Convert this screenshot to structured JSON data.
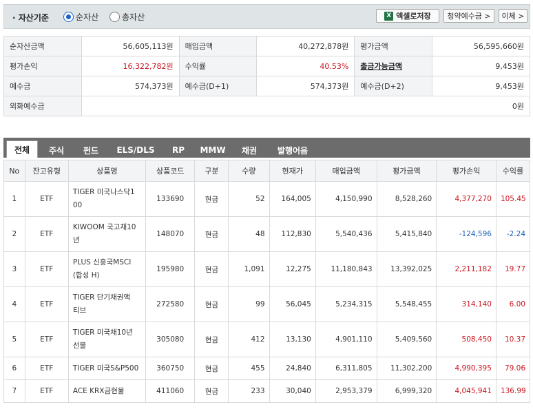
{
  "top": {
    "basis_label": "· 자산기준",
    "radio_net": "순자산",
    "radio_total": "총자산",
    "excel_button": "엑셀로저장",
    "subscription_button": "청약예수금 >",
    "transfer_button": "이체 >"
  },
  "summary": {
    "net_assets_label": "순자산금액",
    "net_assets": "56,605,113원",
    "purchase_label": "매입금액",
    "purchase": "40,272,878원",
    "valuation_label": "평가금액",
    "valuation": "56,595,660원",
    "pnl_label": "평가손익",
    "pnl": "16,322,782원",
    "return_label": "수익률",
    "return": "40.53%",
    "withdrawable_label": "출금가능금액",
    "withdrawable": "9,453원",
    "deposit_label": "예수금",
    "deposit": "574,373원",
    "deposit_d1_label": "예수금(D+1)",
    "deposit_d1": "574,373원",
    "deposit_d2_label": "예수금(D+2)",
    "deposit_d2": "9,453원",
    "fx_label": "외화예수금",
    "fx": "0원"
  },
  "tabs": [
    "전체",
    "주식",
    "펀드",
    "ELS/DLS",
    "RP",
    "MMW",
    "채권",
    "발행어음"
  ],
  "table": {
    "headers": [
      "No",
      "잔고유형",
      "상품명",
      "상품코드",
      "구분",
      "수량",
      "현재가",
      "매입금액",
      "평가금액",
      "평가손익",
      "수익률"
    ],
    "rows": [
      {
        "no": "1",
        "type": "ETF",
        "name": "TIGER 미국나스닥1\n00",
        "code": "133690",
        "kind": "현금",
        "qty": "52",
        "price": "164,005",
        "buy": "4,150,990",
        "eval": "8,528,260",
        "pnl": "4,377,270",
        "ret": "105.45",
        "sign": "pos"
      },
      {
        "no": "2",
        "type": "ETF",
        "name": "KIWOOM 국고채10\n년",
        "code": "148070",
        "kind": "현금",
        "qty": "48",
        "price": "112,830",
        "buy": "5,540,436",
        "eval": "5,415,840",
        "pnl": "-124,596",
        "ret": "-2.24",
        "sign": "neg"
      },
      {
        "no": "3",
        "type": "ETF",
        "name": "PLUS 신흥국MSCI\n(합성 H)",
        "code": "195980",
        "kind": "현금",
        "qty": "1,091",
        "price": "12,275",
        "buy": "11,180,843",
        "eval": "13,392,025",
        "pnl": "2,211,182",
        "ret": "19.77",
        "sign": "pos"
      },
      {
        "no": "4",
        "type": "ETF",
        "name": "TIGER 단기채권액\n티브",
        "code": "272580",
        "kind": "현금",
        "qty": "99",
        "price": "56,045",
        "buy": "5,234,315",
        "eval": "5,548,455",
        "pnl": "314,140",
        "ret": "6.00",
        "sign": "pos"
      },
      {
        "no": "5",
        "type": "ETF",
        "name": "TIGER 미국채10년\n선물",
        "code": "305080",
        "kind": "현금",
        "qty": "412",
        "price": "13,130",
        "buy": "4,901,110",
        "eval": "5,409,560",
        "pnl": "508,450",
        "ret": "10.37",
        "sign": "pos"
      },
      {
        "no": "6",
        "type": "ETF",
        "name": "TIGER 미국S&P500",
        "code": "360750",
        "kind": "현금",
        "qty": "455",
        "price": "24,840",
        "buy": "6,311,805",
        "eval": "11,302,200",
        "pnl": "4,990,395",
        "ret": "79.06",
        "sign": "pos"
      },
      {
        "no": "7",
        "type": "ETF",
        "name": "ACE KRX금현물",
        "code": "411060",
        "kind": "현금",
        "qty": "233",
        "price": "30,040",
        "buy": "2,953,379",
        "eval": "6,999,320",
        "pnl": "4,045,941",
        "ret": "136.99",
        "sign": "pos"
      }
    ]
  },
  "colors": {
    "positive": "#c8141e",
    "negative": "#1a5fb4",
    "tabbar": "#6c6c6c"
  }
}
